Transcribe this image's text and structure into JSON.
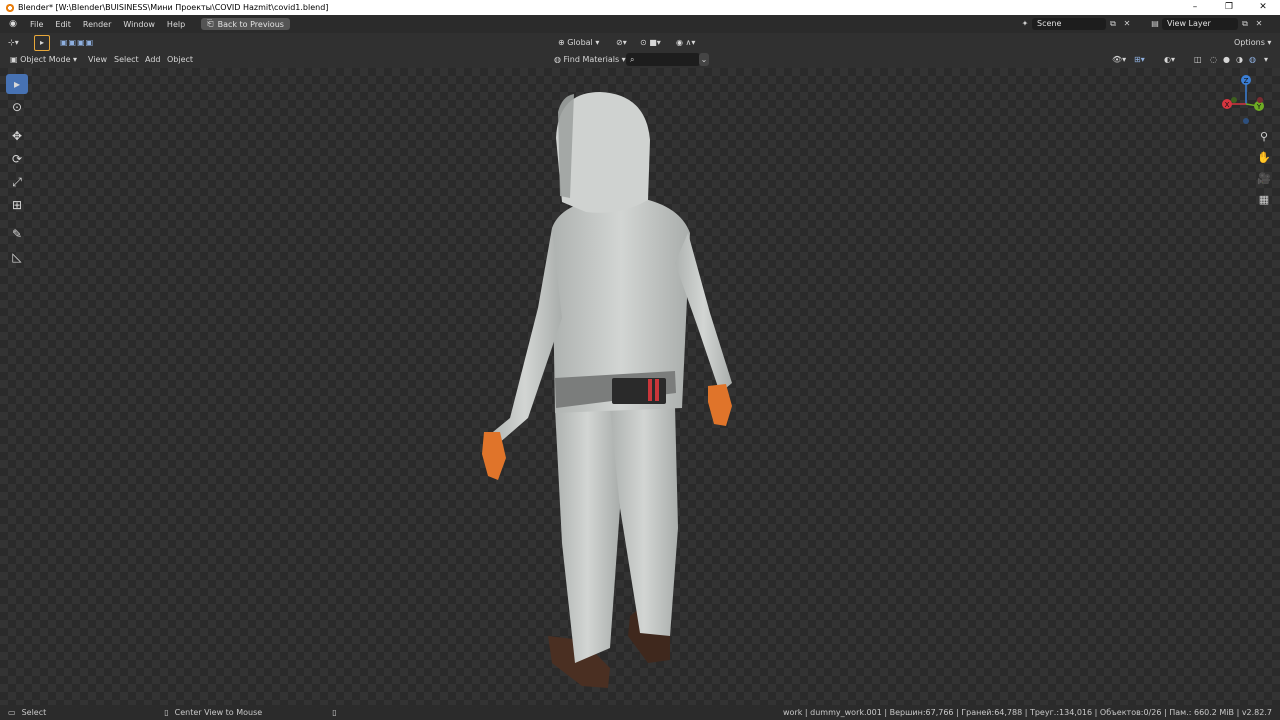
{
  "window": {
    "title": "Blender* [W:\\Blender\\BUISINESS\\Мини Проекты\\COVID Hazmit\\covid1.blend]",
    "controls": [
      "–",
      "❐",
      "✕"
    ]
  },
  "menubar": {
    "items": [
      "File",
      "Edit",
      "Render",
      "Window",
      "Help"
    ],
    "back_label": "Back to Previous",
    "scene": "Scene",
    "view_layer": "View Layer"
  },
  "tool_header": {
    "orientation": "Global",
    "options": "Options"
  },
  "view_header": {
    "mode": "Object Mode",
    "menus": [
      "View",
      "Select",
      "Add",
      "Object"
    ],
    "find": "Find Materials",
    "search_placeholder": ""
  },
  "gizmo": {
    "x": "X",
    "y": "Y",
    "z": "Z"
  },
  "statusbar": {
    "select": "Select",
    "center": "Center View to Mouse",
    "stats": "work | dummy_work.001 | Вершин:67,766 | Граней:64,788 | Треуг.:134,016 | Объектов:0/26 | Пам.: 660.2 MiB | v2.82.7"
  },
  "colors": {
    "accent": "#4772b3",
    "suit": "#c9ccca",
    "skin": "#e0742a",
    "boots": "#4a2f22"
  }
}
